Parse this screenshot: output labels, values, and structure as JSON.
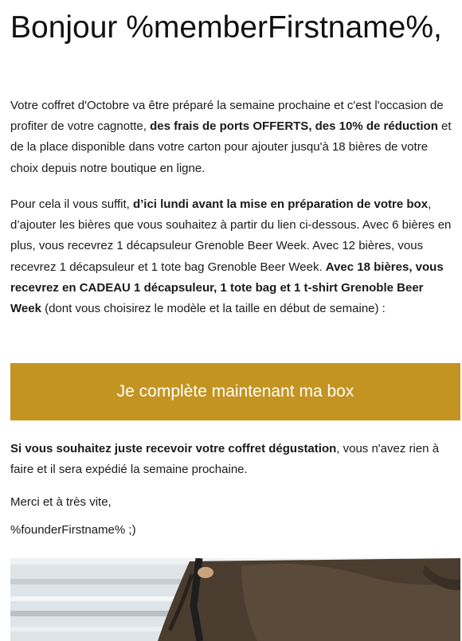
{
  "greeting": "Bonjour %memberFirstname%,",
  "intro": {
    "t1": "Votre coffret d'Octobre va être préparé la semaine prochaine et c'est l'occasion de profiter de votre cagnotte, ",
    "b1": "des frais de ports OFFERTS, des 10% de réduction",
    "t2": " et de la place disponible dans votre carton pour ajouter jusqu'à 18 bières de votre choix depuis notre boutique en ligne."
  },
  "details": {
    "t1": "Pour cela il vous suffit, ",
    "b1": "d’ici lundi avant la mise en préparation de votre box",
    "t2": ", d’ajouter les bières que vous souhaitez à partir du lien ci-dessous. Avec 6 bières en plus, vous recevrez 1 décapsuleur Grenoble Beer Week. Avec 12 bières, vous recevrez 1 décapsuleur et 1 tote bag Grenoble Beer Week. ",
    "b2": "Avec 18 bières, vous recevrez en CADEAU 1 décapsuleur, 1 tote bag et 1 t-shirt Grenoble Beer Week",
    "t3": " (dont vous choisirez le modèle et la taille en début de semaine) :"
  },
  "cta_label": "Je complète maintenant ma box",
  "tasting": {
    "b1": "Si vous souhaitez juste recevoir votre coffret dégustation",
    "t1": ", vous n'avez rien à faire et il sera expédié la semaine prochaine."
  },
  "thanks": "Merci et à très vite,",
  "signature": "%founderFirstname% ;)",
  "colors": {
    "accent": "#c39422",
    "text": "#1a1a1a"
  }
}
